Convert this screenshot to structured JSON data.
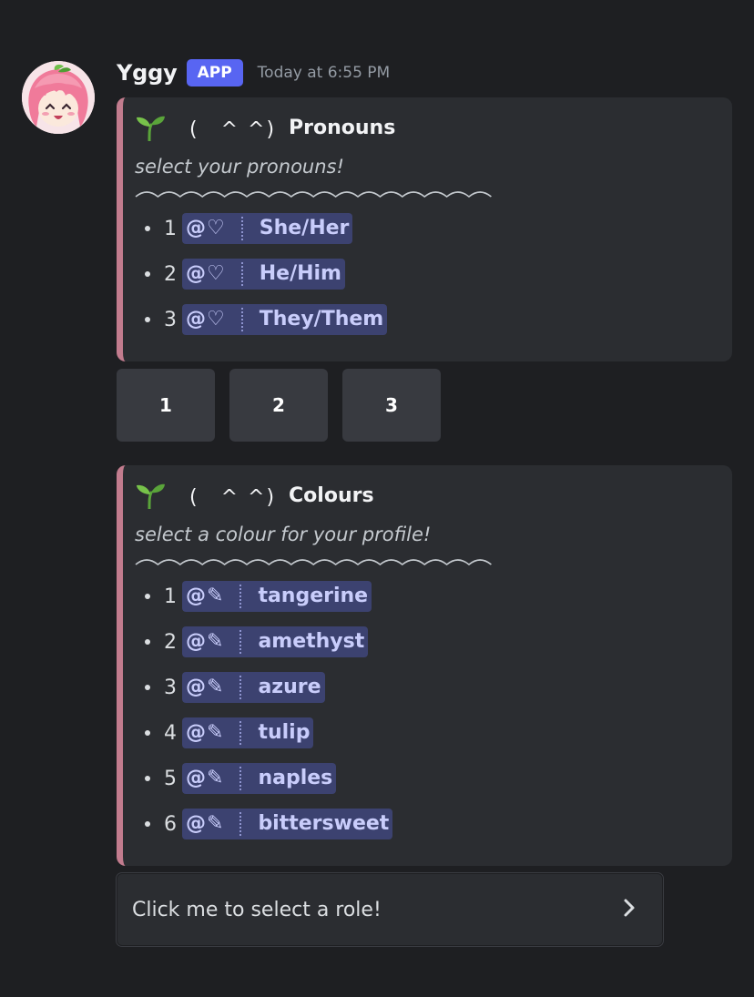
{
  "message": {
    "author": "Yggy",
    "tag": "APP",
    "timestamp": "Today at 6:55 PM"
  },
  "pronouns_embed": {
    "kaomoji": "(　^ ^)",
    "title": "Pronouns",
    "subtitle": "select your pronouns!",
    "items": [
      {
        "num": "1",
        "prefix": "@",
        "glyph": "♡",
        "name": "She/Her"
      },
      {
        "num": "2",
        "prefix": "@",
        "glyph": "♡",
        "name": "He/Him"
      },
      {
        "num": "3",
        "prefix": "@",
        "glyph": "♡",
        "name": "They/Them"
      }
    ]
  },
  "pronoun_buttons": [
    "1",
    "2",
    "3"
  ],
  "colours_embed": {
    "kaomoji": "(　^ ^)",
    "title": "Colours",
    "subtitle": "select a colour for your profile!",
    "items": [
      {
        "num": "1",
        "prefix": "@",
        "glyph": "✎",
        "name": "tangerine"
      },
      {
        "num": "2",
        "prefix": "@",
        "glyph": "✎",
        "name": "amethyst"
      },
      {
        "num": "3",
        "prefix": "@",
        "glyph": "✎",
        "name": "azure"
      },
      {
        "num": "4",
        "prefix": "@",
        "glyph": "✎",
        "name": "tulip"
      },
      {
        "num": "5",
        "prefix": "@",
        "glyph": "✎",
        "name": "naples"
      },
      {
        "num": "6",
        "prefix": "@",
        "glyph": "✎",
        "name": "bittersweet"
      }
    ]
  },
  "select_menu": {
    "placeholder": "Click me to select a role!"
  },
  "icons": {
    "title_icon": "sprout-icon",
    "menu_icon": "chevron-right-icon"
  },
  "colors": {
    "background": "#1e1f22",
    "embed_bg": "#2b2d31",
    "embed_border": "#c27c8e",
    "app_tag": "#5865f2",
    "mention_bg": "#3c4270",
    "mention_text": "#c9cdfb",
    "button_bg": "#383a40"
  }
}
